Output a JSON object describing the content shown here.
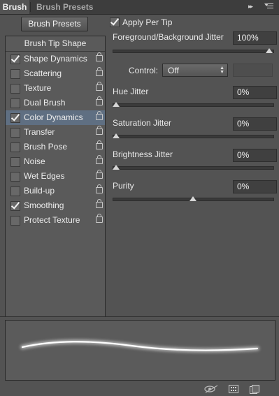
{
  "tabs": [
    {
      "label": "Brush",
      "active": true
    },
    {
      "label": "Brush Presets",
      "active": false
    }
  ],
  "panel_menu": {
    "collapse_glyph": "▸▸"
  },
  "brush_presets_button": "Brush Presets",
  "list": {
    "header": "Brush Tip Shape",
    "items": [
      {
        "label": "Shape Dynamics",
        "checked": true,
        "selected": false
      },
      {
        "label": "Scattering",
        "checked": false,
        "selected": false
      },
      {
        "label": "Texture",
        "checked": false,
        "selected": false
      },
      {
        "label": "Dual Brush",
        "checked": false,
        "selected": false
      },
      {
        "label": "Color Dynamics",
        "checked": true,
        "selected": true
      },
      {
        "label": "Transfer",
        "checked": false,
        "selected": false
      },
      {
        "label": "Brush Pose",
        "checked": false,
        "selected": false
      },
      {
        "label": "Noise",
        "checked": false,
        "selected": false
      },
      {
        "label": "Wet Edges",
        "checked": false,
        "selected": false
      },
      {
        "label": "Build-up",
        "checked": false,
        "selected": false
      },
      {
        "label": "Smoothing",
        "checked": true,
        "selected": false
      },
      {
        "label": "Protect Texture",
        "checked": false,
        "selected": false
      }
    ]
  },
  "apply_per_tip": {
    "label": "Apply Per Tip",
    "checked": true
  },
  "fg_bg_jitter": {
    "label": "Foreground/Background Jitter",
    "value": "100%",
    "level": 1.0
  },
  "control": {
    "label": "Control:",
    "value": "Off"
  },
  "hue_jitter": {
    "label": "Hue Jitter",
    "value": "0%",
    "level": 0.0
  },
  "saturation_jitter": {
    "label": "Saturation Jitter",
    "value": "0%",
    "level": 0.0
  },
  "brightness_jitter": {
    "label": "Brightness Jitter",
    "value": "0%",
    "level": 0.0
  },
  "purity": {
    "label": "Purity",
    "value": "0%",
    "level": 0.5
  },
  "colors": {
    "selected_row": "#5f6f82",
    "panel": "#535353",
    "stroke": "#ffffff"
  },
  "footer_icons": [
    "eye-toggle-icon",
    "grid-icon",
    "new-preset-icon"
  ]
}
